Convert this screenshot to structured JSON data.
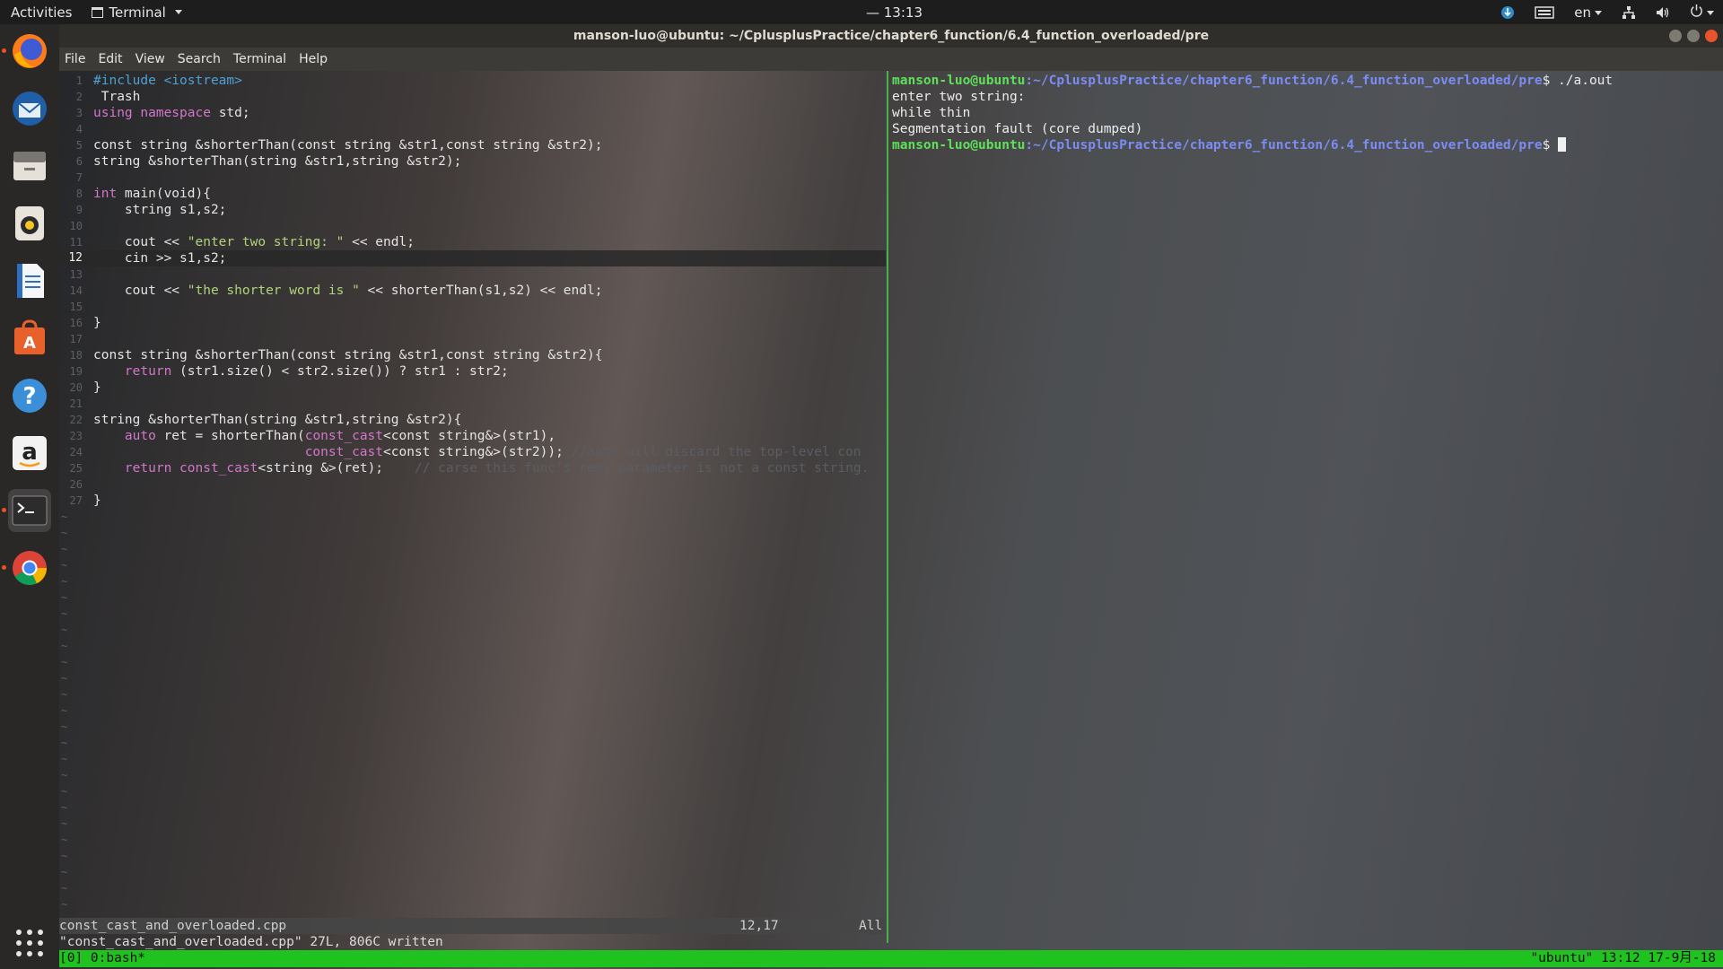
{
  "topbar": {
    "activities": "Activities",
    "app_name": "Terminal",
    "clock": "— 13:13",
    "lang": "en"
  },
  "dock": {
    "items": [
      "firefox",
      "thunderbird",
      "files",
      "rhythmbox",
      "libreoffice-writer",
      "ubuntu-software",
      "help",
      "amazon",
      "terminal",
      "chrome"
    ]
  },
  "window": {
    "title": "manson-luo@ubuntu: ~/CplusplusPractice/chapter6_function/6.4_function_overloaded/pre",
    "menu": [
      "File",
      "Edit",
      "View",
      "Search",
      "Terminal",
      "Help"
    ]
  },
  "vim": {
    "lines": [
      {
        "n": "1",
        "text": "#include <iostream>"
      },
      {
        "n": "2",
        "text": " Trash"
      },
      {
        "n": "3",
        "text": "using namespace std;"
      },
      {
        "n": "4",
        "text": ""
      },
      {
        "n": "5",
        "text": "const string &shorterThan(const string &str1,const string &str2);"
      },
      {
        "n": "6",
        "text": "string &shorterThan(string &str1,string &str2);"
      },
      {
        "n": "7",
        "text": ""
      },
      {
        "n": "8",
        "text": "int main(void){"
      },
      {
        "n": "9",
        "text": "    string s1,s2;"
      },
      {
        "n": "10",
        "text": ""
      },
      {
        "n": "11",
        "text": "    cout << \"enter two string: \" << endl;"
      },
      {
        "n": "12",
        "text": "    cin >> s1,s2;"
      },
      {
        "n": "13",
        "text": ""
      },
      {
        "n": "14",
        "text": "    cout << \"the shorter word is \" << shorterThan(s1,s2) << endl;"
      },
      {
        "n": "15",
        "text": ""
      },
      {
        "n": "16",
        "text": "}"
      },
      {
        "n": "17",
        "text": ""
      },
      {
        "n": "18",
        "text": "const string &shorterThan(const string &str1,const string &str2){"
      },
      {
        "n": "19",
        "text": "    return (str1.size() < str2.size()) ? str1 : str2;"
      },
      {
        "n": "20",
        "text": "}"
      },
      {
        "n": "21",
        "text": ""
      },
      {
        "n": "22",
        "text": "string &shorterThan(string &str1,string &str2){"
      },
      {
        "n": "23",
        "text": "    auto ret = shorterThan(const_cast<const string&>(str1),"
      },
      {
        "n": "24",
        "text": "                           const_cast<const string&>(str2)); //auto will discard the top-level con"
      },
      {
        "n": "25",
        "text": "    return const_cast<string &>(ret);    // carse this func's real parameter is not a const string."
      },
      {
        "n": "26",
        "text": ""
      },
      {
        "n": "27",
        "text": "}"
      }
    ],
    "current_line": "12",
    "status_file": "const_cast_and_overloaded.cpp",
    "status_pos": "12,17",
    "status_all": "All",
    "message": "\"const_cast_and_overloaded.cpp\" 27L, 806C written"
  },
  "shell": {
    "user": "manson-luo@ubuntu",
    "path": ":~/CplusplusPractice/chapter6_function/6.4_function_overloaded/pre",
    "command": "$ ./a.out",
    "output": [
      "enter two string:",
      "while thin",
      "Segmentation fault (core dumped)"
    ],
    "prompt_end": "$ "
  },
  "tmux": {
    "left": "[0] 0:bash*",
    "right": "\"ubuntu\" 13:12 17-9月-18"
  },
  "colors": {
    "tmux_bar": "#1fc21f",
    "shell_user": "#5fe05a",
    "shell_path": "#7b8cf2",
    "vim_keyword": "#d177c9",
    "vim_string": "#b1d47a"
  }
}
